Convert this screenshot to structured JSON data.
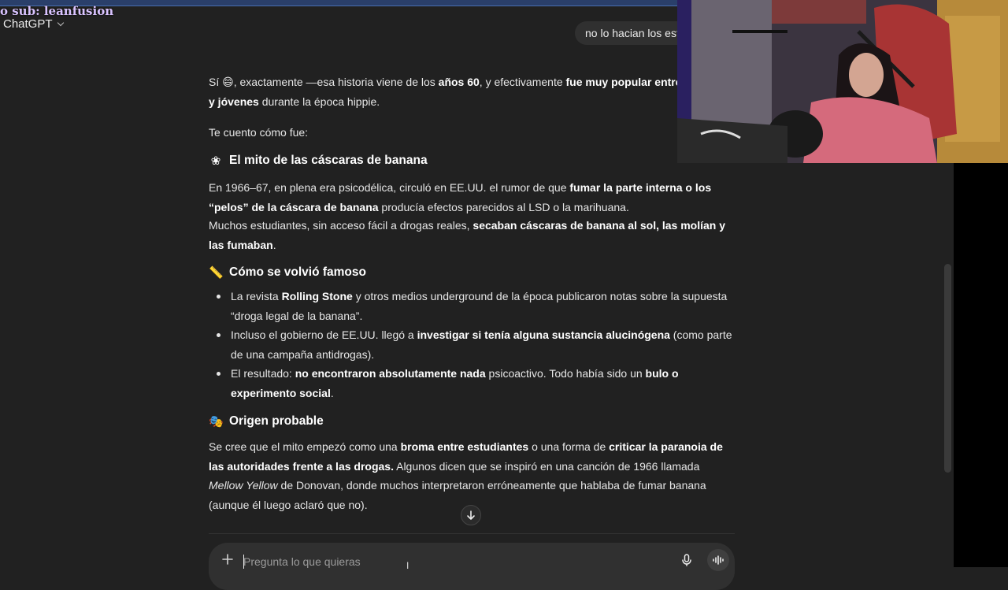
{
  "overlay": {
    "sub_text": "o sub: leanfusion"
  },
  "header": {
    "model_name": "ChatGPT"
  },
  "user_message": {
    "text": "no lo hacian los est"
  },
  "answer": {
    "intro_p1": [
      {
        "t": "Sí "
      },
      {
        "t": "😄",
        "e": true
      },
      {
        "t": ", exactamente —esa historia viene de los "
      },
      {
        "t": "años 60",
        "b": true
      },
      {
        "t": ", y efectivamente "
      },
      {
        "t": "fue muy popular entre e",
        "b": true
      }
    ],
    "intro_p1_line2": [
      {
        "t": "y jóvenes",
        "b": true
      },
      {
        "t": " durante la época hippie."
      }
    ],
    "intro_p2": "Te cuento cómo fue:",
    "section1": {
      "icon": "flower-icon",
      "title": "El mito de las cáscaras de banana",
      "para1": [
        {
          "t": "En 1966–67, en plena era psicodélica, circuló en EE.UU. el rumor de que "
        },
        {
          "t": "fumar la parte interna o los “pelos” de la cáscara de banana",
          "b": true
        },
        {
          "t": " producía efectos parecidos al LSD o la marihuana."
        }
      ],
      "para2": [
        {
          "t": "Muchos estudiantes, sin acceso fácil a drogas reales, "
        },
        {
          "t": "secaban cáscaras de banana al sol, las molían y las fumaban",
          "b": true
        },
        {
          "t": "."
        }
      ]
    },
    "section2": {
      "icon": "ruler-icon",
      "title": "Cómo se volvió famoso",
      "bullets": [
        [
          {
            "t": "La revista "
          },
          {
            "t": "Rolling Stone",
            "b": true
          },
          {
            "t": " y otros medios underground de la época publicaron notas sobre la supuesta “droga legal de la banana”."
          }
        ],
        [
          {
            "t": "Incluso el gobierno de EE.UU. llegó a "
          },
          {
            "t": "investigar si tenía alguna sustancia alucinógena",
            "b": true
          },
          {
            "t": " (como parte de una campaña antidrogas)."
          }
        ],
        [
          {
            "t": "El resultado: "
          },
          {
            "t": "no encontraron absolutamente nada",
            "b": true
          },
          {
            "t": " psicoactivo. Todo había sido un "
          },
          {
            "t": "bulo o experimento social",
            "b": true
          },
          {
            "t": "."
          }
        ]
      ]
    },
    "section3": {
      "icon": "theater-masks-icon",
      "title": "Origen probable",
      "para": [
        {
          "t": "Se cree que el mito empezó como una "
        },
        {
          "t": "broma entre estudiantes",
          "b": true
        },
        {
          "t": " o una forma de "
        },
        {
          "t": "criticar la paranoia de las autoridades frente a las drogas.",
          "b": true
        },
        {
          "t": " Algunos dicen que se inspiró en una canción de 1966 llamada "
        },
        {
          "t": "Mellow Yellow",
          "i": true
        },
        {
          "t": " de Donovan, donde muchos interpretaron erróneamente que hablaba de fumar banana (aunque él luego aclaró que no)."
        }
      ]
    }
  },
  "composer": {
    "placeholder": "Pregunta lo que quieras"
  },
  "icons": {
    "plus": "plus-icon",
    "mic": "microphone-icon",
    "voice": "voice-mode-icon",
    "scroll": "arrow-down-icon"
  },
  "colors": {
    "background": "#212121",
    "bubble": "#303030",
    "text": "#ececec"
  }
}
